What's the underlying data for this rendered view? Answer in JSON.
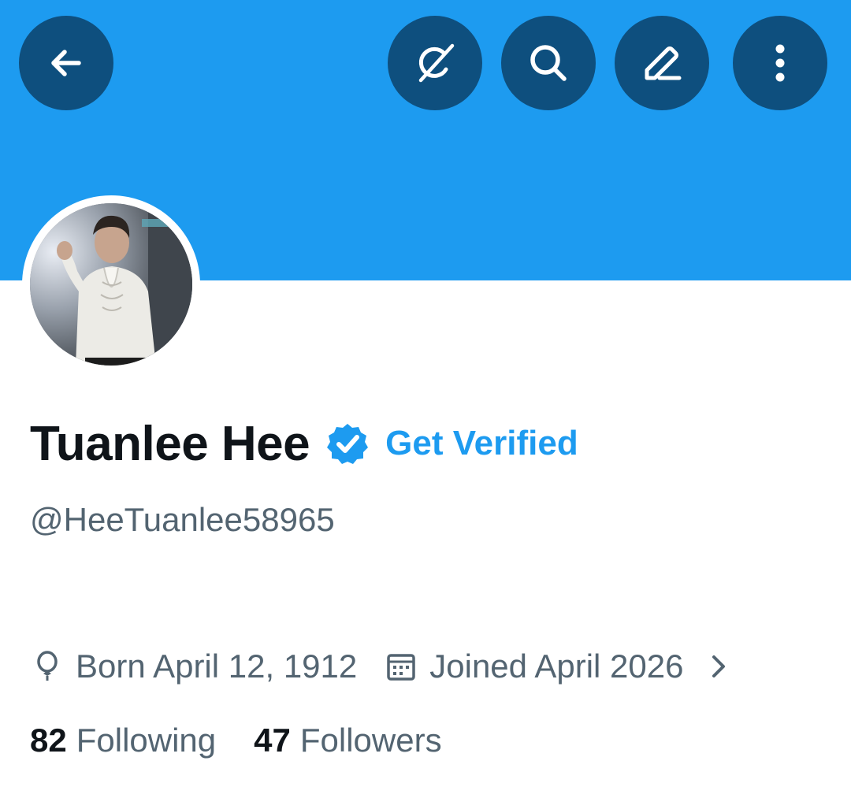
{
  "profile": {
    "display_name": "Tuanlee Hee",
    "handle": "@HeeTuanlee58965",
    "get_verified_label": "Get Verified",
    "born": "Born April 12, 1912",
    "joined": "Joined April 2026",
    "following_count": "82",
    "following_label": "Following",
    "followers_count": "47",
    "followers_label": "Followers"
  },
  "header": {
    "buttons": [
      "back-arrow-icon",
      "grok-icon",
      "search-icon",
      "edit-pencil-icon",
      "more-vertical-icon"
    ]
  },
  "colors": {
    "banner": "#1d9bf0",
    "header_button_bg": "#0e4f7e",
    "accent": "#1d9bf0",
    "primary_text": "#0f1419",
    "secondary_text": "#536471"
  }
}
